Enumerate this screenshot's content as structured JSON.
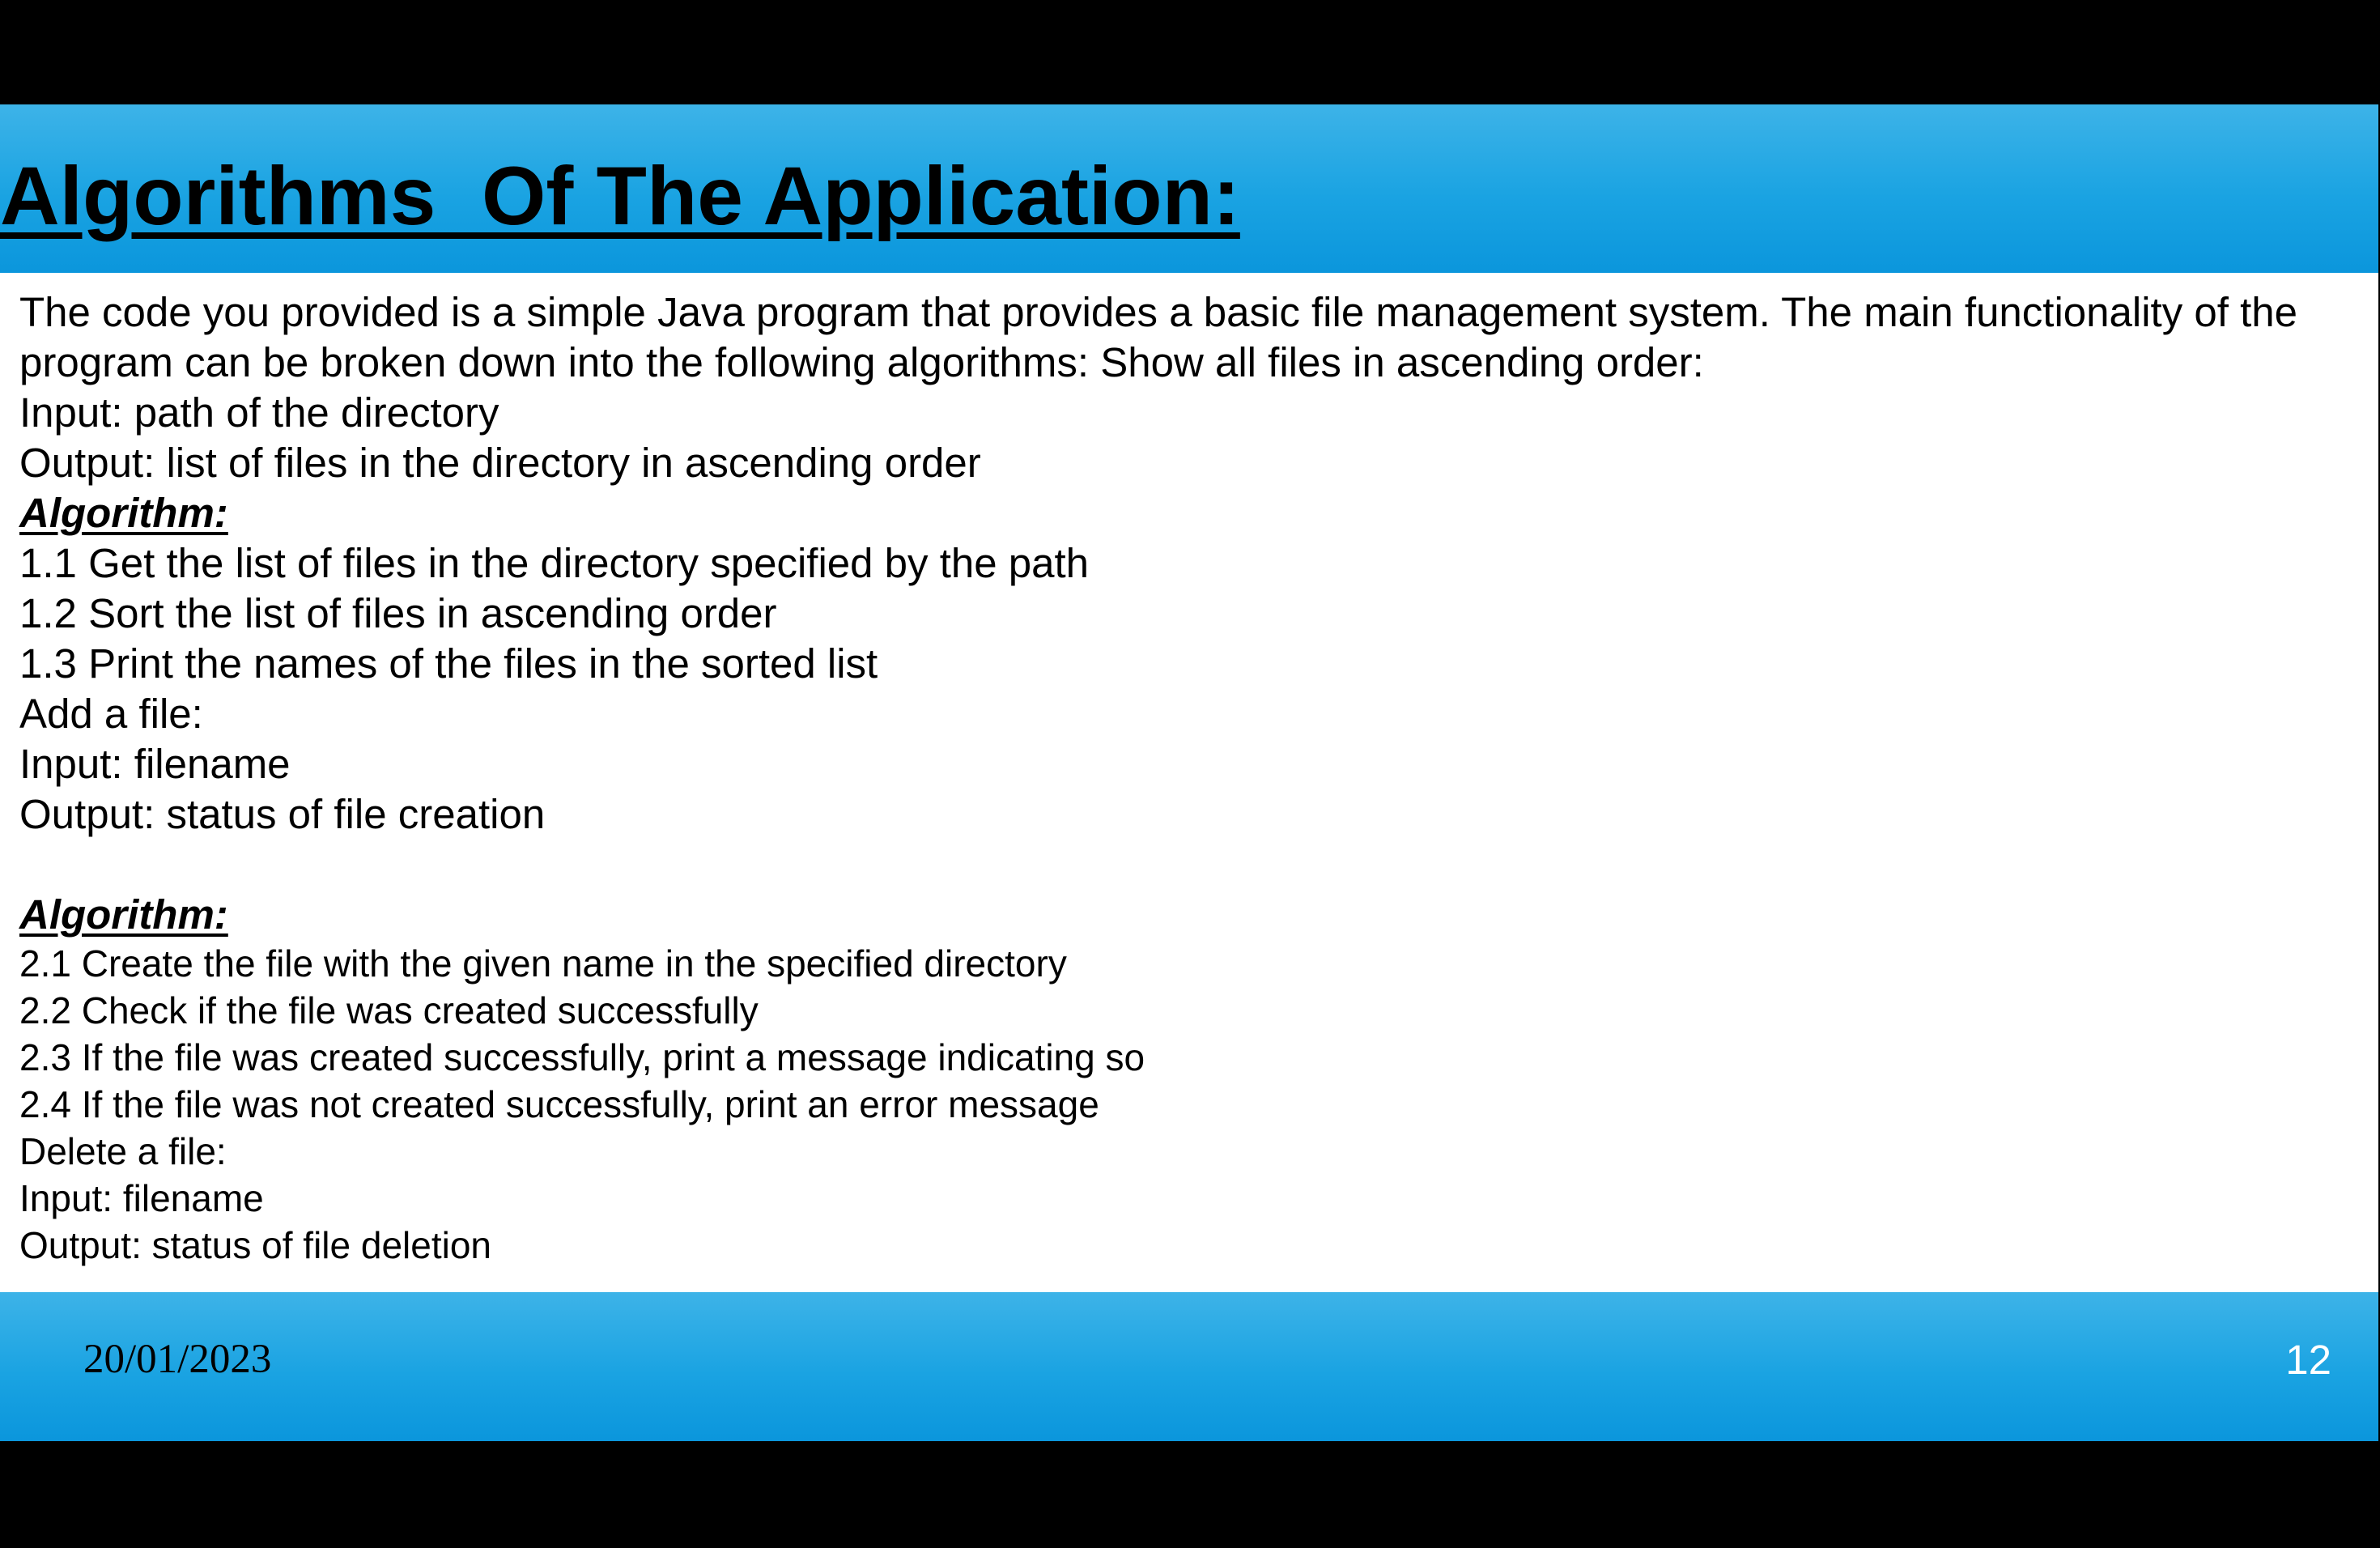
{
  "slide": {
    "title": "Algorithms  Of The Application:",
    "paragraphs": [
      "The code you provided is a simple Java program that provides a basic file management system. The main functionality of the program can be broken down into the following algorithms: Show all files in ascending order:",
      "Input: path of the directory",
      "Output: list of files in the directory in ascending order",
      "Algorithm:",
      "1.1 Get the list of files in the directory specified by the path",
      "1.2 Sort the list of files in ascending order",
      "1.3 Print the names of the files in the sorted list",
      "Add a file:",
      "Input: filename",
      "Output: status of file creation",
      "Algorithm:",
      "2.1 Create the file with the given name in the specified directory",
      "2.2 Check if the file was created successfully",
      "2.3 If the file was created successfully, print a message indicating so",
      "2.4 If the file was not created successfully, print an error message",
      "Delete a file:",
      "Input: filename",
      "Output: status of file deletion"
    ],
    "footer": {
      "date": "20/01/2023",
      "page_number": "12"
    }
  },
  "colors": {
    "band_top": "#3db3e8",
    "band_bottom": "#0b96dc",
    "background": "#000000",
    "slide_background": "#ffffff"
  }
}
